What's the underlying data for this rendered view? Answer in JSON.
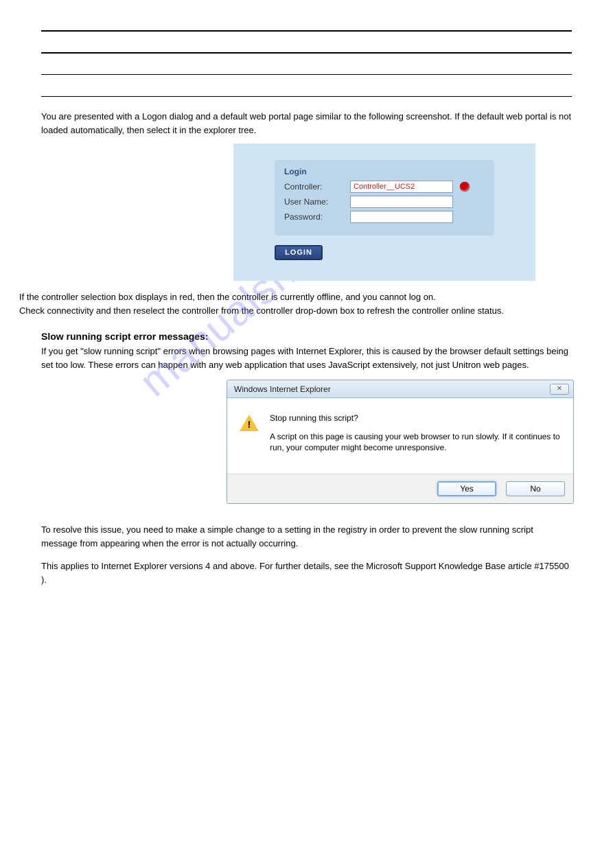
{
  "watermark_text": "manualshive.com",
  "body_text": {
    "para1": "You are presented with a Logon dialog and a default web portal page similar to the following screenshot. If the default web portal is not loaded automatically, then select it in the explorer tree.",
    "para2a": "If the controller selection box displays in red, then the controller is currently offline, and you cannot log on.",
    "para2b": "Check connectivity and then reselect the controller from the controller drop-down box to refresh the controller online status.",
    "subsection_title": "Slow running script error messages:",
    "para3": "If you get \"slow running script\" errors when browsing pages with Internet Explorer, this is caused by the browser default settings being set too low. These errors can happen with any web application that uses JavaScript extensively, not just Unitron web pages.",
    "para4": "To resolve this issue, you need to make a simple change to a setting in the registry in order to prevent the slow running script message from appearing when the error is not actually occurring.",
    "para5a": "This applies to Internet Explorer versions 4 and above. For further details, see the Microsoft Support Knowledge Base article #175500",
    "para5b": ")."
  },
  "login_card": {
    "panel_title": "Login",
    "controller_label": "Controller:",
    "controller_value": "Controller__UCS2",
    "username_label": "User Name:",
    "username_value": "",
    "password_label": "Password:",
    "password_value": "",
    "login_button": "LOGIN"
  },
  "dialog": {
    "title": "Windows Internet Explorer",
    "close_glyph": "✕",
    "question": "Stop running this script?",
    "body": "A script on this page is causing your web browser to run slowly. If it continues to run, your computer might become unresponsive.",
    "yes": "Yes",
    "no": "No"
  },
  "icons": {
    "status_dot": "status-dot",
    "warning_triangle": "warning-icon"
  }
}
